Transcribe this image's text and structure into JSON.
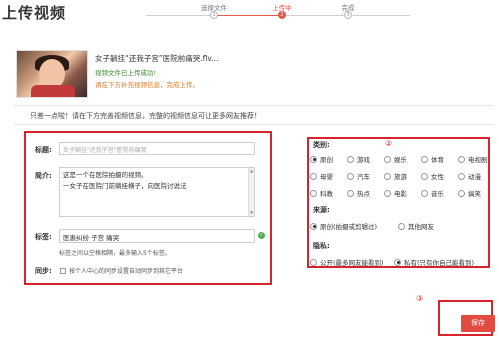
{
  "page": {
    "title": "上传视频"
  },
  "steps": [
    {
      "label": "选择文件",
      "num": "1",
      "active": false
    },
    {
      "label": "上传中",
      "num": "2",
      "active": true
    },
    {
      "label": "完成",
      "num": "3",
      "active": false
    }
  ],
  "upload": {
    "file_name": "女子躺挂“还我子宫”医院前痛哭.flv...",
    "success_text": "视频文件已上传成功!",
    "tip_text": "请在下方补充视频信息，完成上传。"
  },
  "notice": "只差一点啦！请在下方完善视频信息，完整的视频信息可让更多网友推荐！",
  "form": {
    "title_label": "标题:",
    "title_placeholder": "女子躺挂\"还我子宫\"医院前痛哭",
    "desc_label": "简介:",
    "desc_lines": [
      "这是一个在医院拍摄的视频。",
      "一女子在医院门前躺挂横子，向医院讨说法"
    ],
    "tags_label": "标签:",
    "tags_value": "医患纠纷 子宫 痛哭",
    "tags_hint": "标签之间以空格相隔，最多输入5个标签。",
    "sync_label": "同步:",
    "sync_text": "按个人中心的同步设置自动同步到其它平台"
  },
  "category": {
    "label": "类别:",
    "options": [
      {
        "label": "原创",
        "selected": true
      },
      {
        "label": "游戏",
        "selected": false
      },
      {
        "label": "娱乐",
        "selected": false
      },
      {
        "label": "体育",
        "selected": false
      },
      {
        "label": "电视剧",
        "selected": false
      },
      {
        "label": "母婴",
        "selected": false
      },
      {
        "label": "汽车",
        "selected": false
      },
      {
        "label": "旅游",
        "selected": false
      },
      {
        "label": "女性",
        "selected": false
      },
      {
        "label": "动漫",
        "selected": false
      },
      {
        "label": "科教",
        "selected": false
      },
      {
        "label": "热点",
        "selected": false
      },
      {
        "label": "电影",
        "selected": false
      },
      {
        "label": "音乐",
        "selected": false
      },
      {
        "label": "搞笑",
        "selected": false
      }
    ]
  },
  "source": {
    "label": "来源:",
    "options": [
      {
        "label": "原创(拍摄或剪辑过)",
        "selected": true
      },
      {
        "label": "其他网友",
        "selected": false
      }
    ]
  },
  "privacy": {
    "label": "隐私:",
    "options": [
      {
        "label": "公开(最多网友能看到)",
        "selected": false
      },
      {
        "label": "私有(只有你自己能看到)",
        "selected": true
      }
    ]
  },
  "markers": {
    "one": "①",
    "two": "②",
    "three": "③"
  },
  "save_label": "保存",
  "colors": {
    "accent": "#e05a4e",
    "highlight": "#d8232a",
    "success": "#3a8a2a",
    "tip": "#e0792a"
  }
}
